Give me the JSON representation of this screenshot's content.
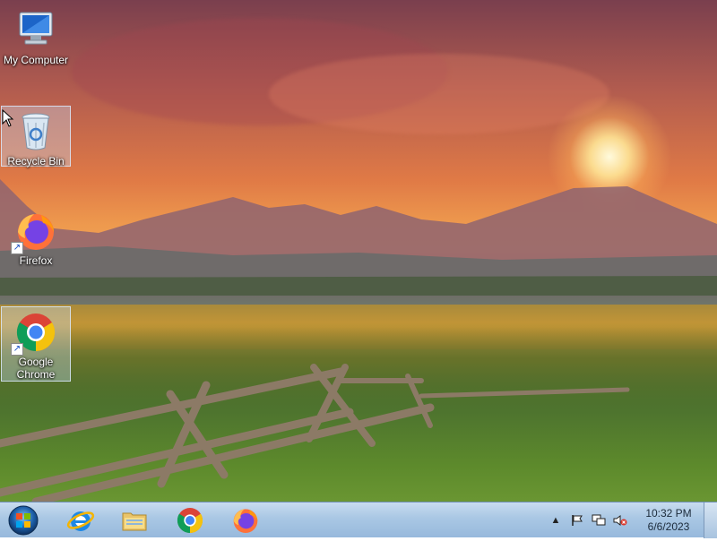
{
  "desktop": {
    "icons": [
      {
        "label": "My Computer",
        "icon": "computer-icon"
      },
      {
        "label": "Recycle Bin",
        "icon": "recycle-bin-icon"
      },
      {
        "label": "Firefox",
        "icon": "firefox-icon"
      },
      {
        "label": "Google Chrome",
        "icon": "chrome-icon"
      }
    ],
    "selected": [
      "Recycle Bin",
      "Google Chrome"
    ]
  },
  "taskbar": {
    "start": {
      "icon": "windows-start-icon"
    },
    "pinned": [
      {
        "name": "Internet Explorer",
        "icon": "internet-explorer-icon"
      },
      {
        "name": "Windows Explorer",
        "icon": "file-explorer-icon"
      },
      {
        "name": "Google Chrome",
        "icon": "chrome-icon"
      },
      {
        "name": "Firefox",
        "icon": "firefox-icon"
      }
    ],
    "tray": {
      "icons": [
        "show-hidden-icons-icon",
        "action-center-flag-icon",
        "network-icon",
        "volume-muted-icon"
      ],
      "time": "10:32 PM",
      "date": "6/6/2023"
    }
  },
  "colors": {
    "taskbar": "#a9c7e4",
    "sky": "#e07a46",
    "field": "#c69736"
  }
}
